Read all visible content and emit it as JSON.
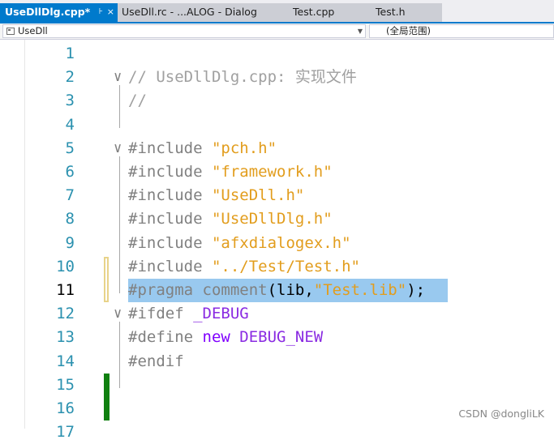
{
  "tabs": [
    {
      "label": "UseDllDlg.cpp*",
      "active": true
    },
    {
      "label": "UseDll.rc - ...ALOG - Dialog",
      "active": false
    },
    {
      "label": "Test.cpp",
      "active": false
    },
    {
      "label": "Test.h",
      "active": false
    }
  ],
  "tab_icons": {
    "pin": "⊦",
    "close": "×"
  },
  "navbar": {
    "project": "UseDll",
    "scope": "(全局范围)"
  },
  "editor": {
    "current_line": 11,
    "lines": [
      {
        "n": "1",
        "tokens": []
      },
      {
        "n": "2",
        "tokens": [
          {
            "t": "// UseDllDlg.cpp: 实现文件",
            "c": "comment"
          }
        ]
      },
      {
        "n": "3",
        "tokens": [
          {
            "t": "//",
            "c": "comment"
          }
        ]
      },
      {
        "n": "4",
        "tokens": []
      },
      {
        "n": "5",
        "tokens": [
          {
            "t": "#include ",
            "c": "pre"
          },
          {
            "t": "\"pch.h\"",
            "c": "str"
          }
        ]
      },
      {
        "n": "6",
        "tokens": [
          {
            "t": "#include ",
            "c": "pre"
          },
          {
            "t": "\"framework.h\"",
            "c": "str"
          }
        ]
      },
      {
        "n": "7",
        "tokens": [
          {
            "t": "#include ",
            "c": "pre"
          },
          {
            "t": "\"UseDll.h\"",
            "c": "str"
          }
        ]
      },
      {
        "n": "8",
        "tokens": [
          {
            "t": "#include ",
            "c": "pre"
          },
          {
            "t": "\"UseDllDlg.h\"",
            "c": "str"
          }
        ]
      },
      {
        "n": "9",
        "tokens": [
          {
            "t": "#include ",
            "c": "pre"
          },
          {
            "t": "\"afxdialogex.h\"",
            "c": "str"
          }
        ]
      },
      {
        "n": "10",
        "tokens": [
          {
            "t": "#include ",
            "c": "pre"
          },
          {
            "t": "\"../Test/Test.h\"",
            "c": "str"
          }
        ]
      },
      {
        "n": "11",
        "tokens": [
          {
            "t": "#pragma ",
            "c": "pre"
          },
          {
            "t": "comment",
            "c": "pre"
          },
          {
            "t": "(lib,",
            "c": "plain"
          },
          {
            "t": "\"Test.lib\"",
            "c": "str"
          },
          {
            "t": ");",
            "c": "plain"
          }
        ]
      },
      {
        "n": "12",
        "tokens": [
          {
            "t": "#ifdef ",
            "c": "pre"
          },
          {
            "t": "_DEBUG",
            "c": "macro"
          }
        ]
      },
      {
        "n": "13",
        "tokens": [
          {
            "t": "#define ",
            "c": "pre"
          },
          {
            "t": "new ",
            "c": "key"
          },
          {
            "t": "DEBUG_NEW",
            "c": "macro"
          }
        ]
      },
      {
        "n": "14",
        "tokens": [
          {
            "t": "#endif",
            "c": "pre"
          }
        ]
      },
      {
        "n": "15",
        "tokens": []
      },
      {
        "n": "16",
        "tokens": []
      },
      {
        "n": "17",
        "tokens": []
      }
    ]
  },
  "watermark": "CSDN @dongliLK",
  "colors": {
    "accent": "#007acc",
    "selection": "#99c9ef",
    "line_number": "#2b91af",
    "string": "#e29d1d",
    "comment": "#a0a0a0"
  }
}
